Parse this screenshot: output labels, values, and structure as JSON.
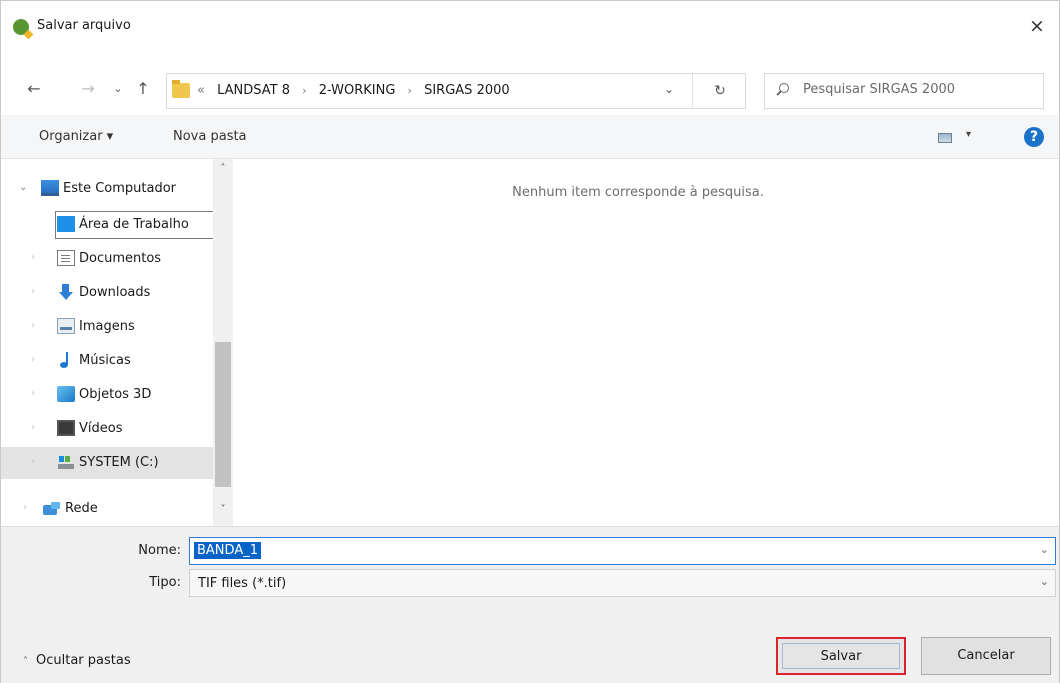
{
  "window": {
    "title": "Salvar arquivo",
    "close_label": "×"
  },
  "nav": {
    "back": "←",
    "forward": "→",
    "recent": "⌄",
    "up": "↑",
    "breadcrumb_lead": "«",
    "breadcrumbs": [
      "LANDSAT 8",
      "2-WORKING",
      "SIRGAS 2000"
    ],
    "separator": "›",
    "address_dropdown": "⌄",
    "refresh": "↻",
    "search_placeholder": "Pesquisar SIRGAS 2000"
  },
  "toolbar": {
    "organize_label": "Organizar ▾",
    "new_folder_label": "Nova pasta",
    "view_dropdown": "▾",
    "help_label": "?"
  },
  "sidebar": {
    "root": {
      "label": "Este Computador",
      "icon": "computer-icon"
    },
    "items": [
      {
        "label": "Área de Trabalho",
        "icon": "desktop-icon"
      },
      {
        "label": "Documentos",
        "icon": "documents-icon"
      },
      {
        "label": "Downloads",
        "icon": "downloads-icon"
      },
      {
        "label": "Imagens",
        "icon": "pictures-icon"
      },
      {
        "label": "Músicas",
        "icon": "music-icon"
      },
      {
        "label": "Objetos 3D",
        "icon": "objects-3d-icon"
      },
      {
        "label": "Vídeos",
        "icon": "videos-icon"
      },
      {
        "label": "SYSTEM (C:)",
        "icon": "drive-icon"
      }
    ],
    "network": {
      "label": "Rede",
      "icon": "network-icon"
    },
    "scroll_up": "˄",
    "scroll_down": "˅"
  },
  "main": {
    "empty_message": "Nenhum item corresponde à pesquisa."
  },
  "form": {
    "name_label": "Nome:",
    "name_value": "BANDA_1",
    "type_label": "Tipo:",
    "type_value": "TIF files (*.tif)",
    "dropdown_glyph": "⌄"
  },
  "footer": {
    "hide_folders_label": "Ocultar pastas",
    "hide_caret": "˄",
    "save_label": "Salvar",
    "cancel_label": "Cancelar"
  },
  "colors": {
    "accent": "#0a64c8",
    "highlight_border": "#d8242c",
    "help_blue": "#1a73c9"
  }
}
